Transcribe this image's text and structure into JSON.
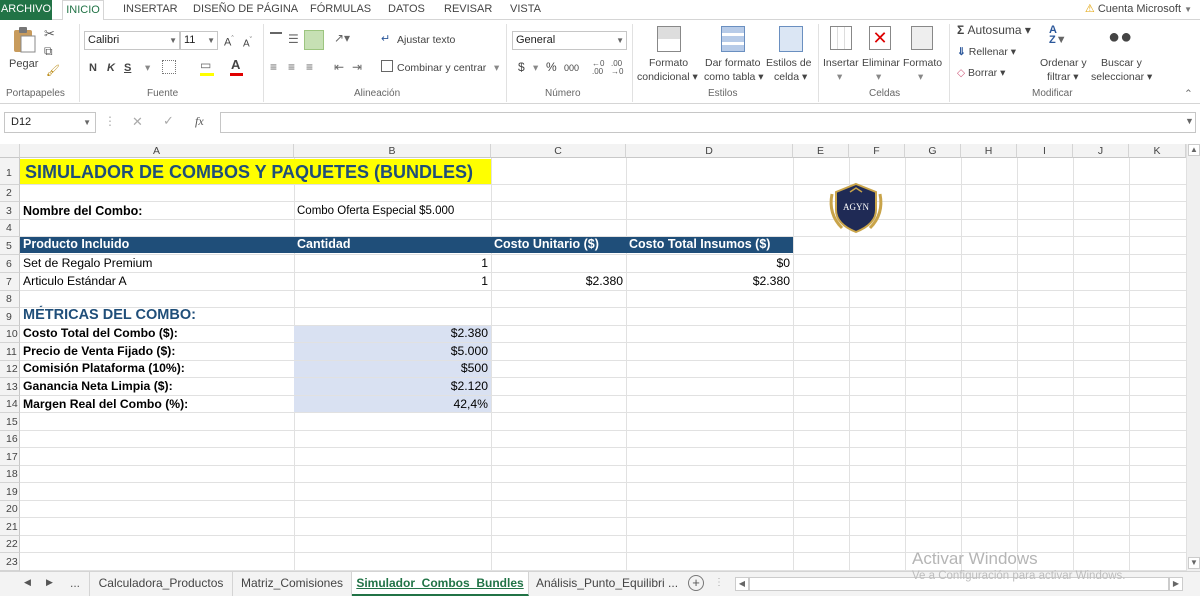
{
  "menu": {
    "items": [
      "ARCHIVO",
      "INICIO",
      "INSERTAR",
      "DISEÑO DE PÁGINA",
      "FÓRMULAS",
      "DATOS",
      "REVISAR",
      "VISTA"
    ],
    "account": "Cuenta Microsoft"
  },
  "ribbon": {
    "paste_label": "Pegar",
    "font_name": "Calibri",
    "font_size": "11",
    "bold": "N",
    "italic": "K",
    "underline": "S",
    "wrap_text": "Ajustar texto",
    "merge_center": "Combinar y centrar",
    "number_format": "General",
    "currency": "$",
    "percent": "%",
    "thousands": "000",
    "cond_format_1": "Formato",
    "cond_format_2": "condicional",
    "table_format_1": "Dar formato",
    "table_format_2": "como tabla",
    "cell_styles_1": "Estilos de",
    "cell_styles_2": "celda",
    "insert": "Insertar",
    "delete": "Eliminar",
    "format": "Formato",
    "autosum": "Autosuma",
    "fill": "Rellenar",
    "clear": "Borrar",
    "sort_1": "Ordenar y",
    "sort_2": "filtrar",
    "find_1": "Buscar y",
    "find_2": "seleccionar",
    "groups": [
      "Portapapeles",
      "Fuente",
      "Alineación",
      "Número",
      "Estilos",
      "Celdas",
      "Modificar"
    ]
  },
  "formula_bar": {
    "name_box": "D12",
    "fx": "fx",
    "value": ""
  },
  "columns": [
    "A",
    "B",
    "C",
    "D",
    "E",
    "F",
    "G",
    "H",
    "I",
    "J",
    "K"
  ],
  "rows": [
    "1",
    "2",
    "3",
    "4",
    "5",
    "6",
    "7",
    "8",
    "9",
    "10",
    "11",
    "12",
    "13",
    "14",
    "15",
    "16",
    "17",
    "18",
    "19",
    "20",
    "21",
    "22",
    "23"
  ],
  "sheet": {
    "title": "SIMULADOR DE COMBOS Y PAQUETES (BUNDLES)",
    "combo_label": "Nombre del Combo:",
    "combo_value": "Combo Oferta Especial $5.000",
    "table_headers": [
      "Producto Incluido",
      "Cantidad",
      "Costo Unitario ($)",
      "Costo Total Insumos ($)"
    ],
    "table_rows": [
      {
        "producto": "Set de Regalo Premium",
        "cantidad": "1",
        "costo_unitario": "",
        "costo_total": "$0"
      },
      {
        "producto": "Articulo Estándar A",
        "cantidad": "1",
        "costo_unitario": "$2.380",
        "costo_total": "$2.380"
      }
    ],
    "metrics_title": "MÉTRICAS DEL COMBO:",
    "metrics": [
      {
        "label": "Costo Total del Combo ($):",
        "value": "$2.380"
      },
      {
        "label": "Precio de Venta Fijado ($):",
        "value": "$5.000"
      },
      {
        "label": "Comisión Plataforma (10%):",
        "value": "$500"
      },
      {
        "label": "Ganancia Neta Limpia ($):",
        "value": "$2.120"
      },
      {
        "label": "Margen Real del Combo (%):",
        "value": "42,4%"
      }
    ],
    "logo_text": "AGYN"
  },
  "tabs": [
    "Calculadora_Productos",
    "Matriz_Comisiones",
    "Simulador_Combos_Bundles",
    "Análisis_Punto_Equilibri ..."
  ],
  "tabs_more": "...",
  "watermark": {
    "line1": "Activar Windows",
    "line2": "Ve a Configuración para activar Windows."
  },
  "colors": {
    "excel_green": "#217346",
    "header_fill": "#1F4E79",
    "title_fill": "#FFFF00",
    "metric_fill": "#D9E1F2",
    "metrics_title": "#1F4E79"
  }
}
